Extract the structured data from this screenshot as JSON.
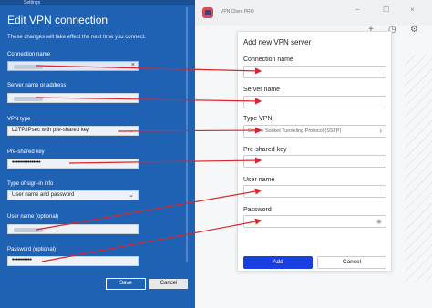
{
  "windows_panel": {
    "topbar_text": "Settings",
    "title": "Edit VPN connection",
    "subtitle": "These changes will take effect the next time you connect.",
    "fields": [
      {
        "label": "Connection name"
      },
      {
        "label": "Server name or address"
      },
      {
        "label": "VPN type",
        "value": "L2TP/IPsec with pre-shared key"
      },
      {
        "label": "Pre-shared key",
        "value": "••••••••••••••••"
      },
      {
        "label": "Type of sign-in info",
        "value": "User name and password"
      },
      {
        "label": "User name (optional)"
      },
      {
        "label": "Password (optional)",
        "value": "•••••••••••"
      }
    ],
    "save_label": "Save",
    "cancel_label": "Cancel"
  },
  "vpn_app": {
    "title": "VPN Client PRO",
    "dialog": {
      "title": "Add new VPN server",
      "fields": [
        {
          "label": "Connection name",
          "value": ""
        },
        {
          "label": "Server name",
          "value": ""
        },
        {
          "label": "Type VPN",
          "value": "Secure Socket Tunneling Protocol (SSTP)"
        },
        {
          "label": "Pre-shared key",
          "value": ""
        },
        {
          "label": "User name",
          "value": ""
        },
        {
          "label": "Password",
          "value": ""
        }
      ],
      "add_label": "Add",
      "cancel_label": "Cancel"
    }
  },
  "icons": [
    "close-icon",
    "chevron-down-icon",
    "chevron-right-icon",
    "eye-icon",
    "plus-icon",
    "clock-icon",
    "settings-icon",
    "minimize-icon",
    "maximize-icon"
  ],
  "colors": {
    "windows_blue": "#1f62b3",
    "arrow_red": "#d8262e",
    "add_button": "#1a3fe0"
  }
}
